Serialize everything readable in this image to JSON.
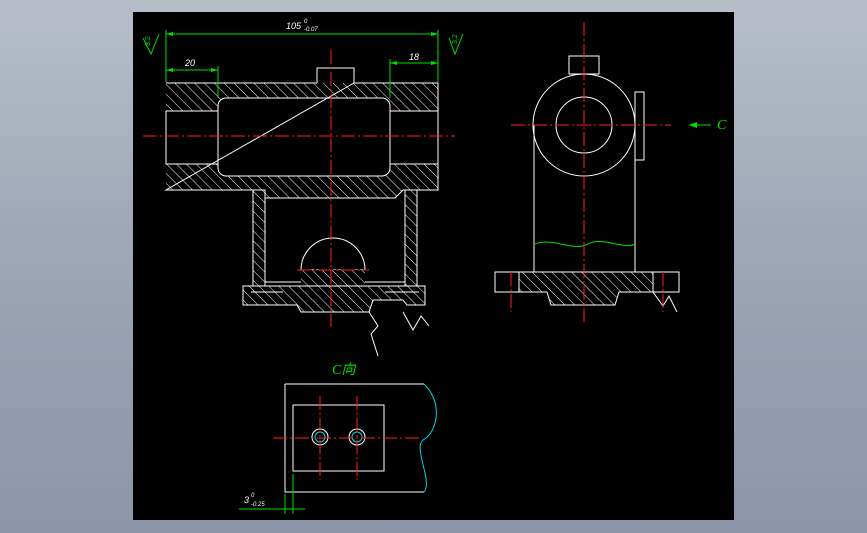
{
  "drawing": {
    "top_dimension_main": "105",
    "top_dimension_tol_upper": "0",
    "top_dimension_tol_lower": "-0.07",
    "left_dimension": "20",
    "right_dimension": "18",
    "roughness_left": "3.2",
    "roughness_right": "3.2",
    "view_arrow_label": "C",
    "view_label": "C向",
    "bottom_dimension_main": "3",
    "bottom_dimension_tol_upper": "0",
    "bottom_dimension_tol_lower": "-0.25"
  },
  "colors": {
    "background": "#000000",
    "outline": "#ffffff",
    "center_line": "#ff2020",
    "dimension": "#00e000",
    "break_line": "#00d8e0"
  }
}
